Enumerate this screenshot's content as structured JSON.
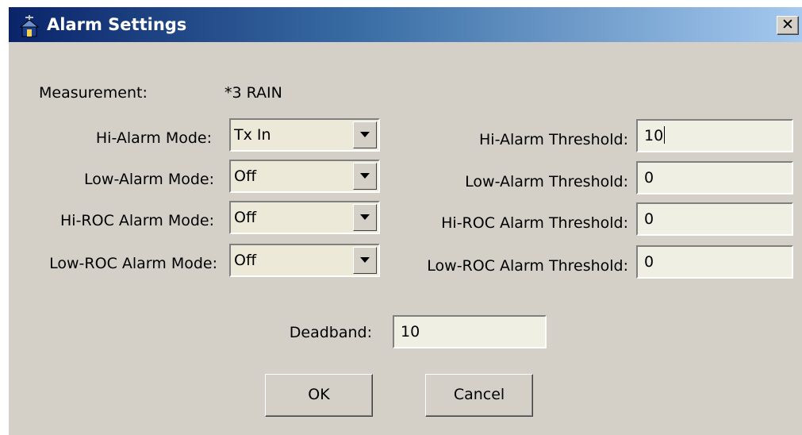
{
  "window": {
    "title": "Alarm Settings",
    "close_label": "✕"
  },
  "measurement": {
    "label": "Measurement:",
    "value": "*3 RAIN"
  },
  "modes": [
    {
      "label": "Hi-Alarm Mode:",
      "value": "Tx In"
    },
    {
      "label": "Low-Alarm Mode:",
      "value": "Off"
    },
    {
      "label": "Hi-ROC Alarm Mode:",
      "value": "Off"
    },
    {
      "label": "Low-ROC Alarm Mode:",
      "value": "Off"
    }
  ],
  "thresholds": [
    {
      "label": "Hi-Alarm Threshold:",
      "value": "10"
    },
    {
      "label": "Low-Alarm Threshold:",
      "value": "0"
    },
    {
      "label": "Hi-ROC Alarm Threshold:",
      "value": "0"
    },
    {
      "label": "Low-ROC Alarm Threshold:",
      "value": "0"
    }
  ],
  "deadband": {
    "label": "Deadband:",
    "value": "10"
  },
  "buttons": {
    "ok": "OK",
    "cancel": "Cancel"
  },
  "icons": {
    "app": "antenna-house-icon",
    "dropdown": "chevron-down-icon"
  },
  "colors": {
    "title_start": "#0a246a",
    "title_end": "#a6caf0",
    "face": "#d4d0c8"
  }
}
